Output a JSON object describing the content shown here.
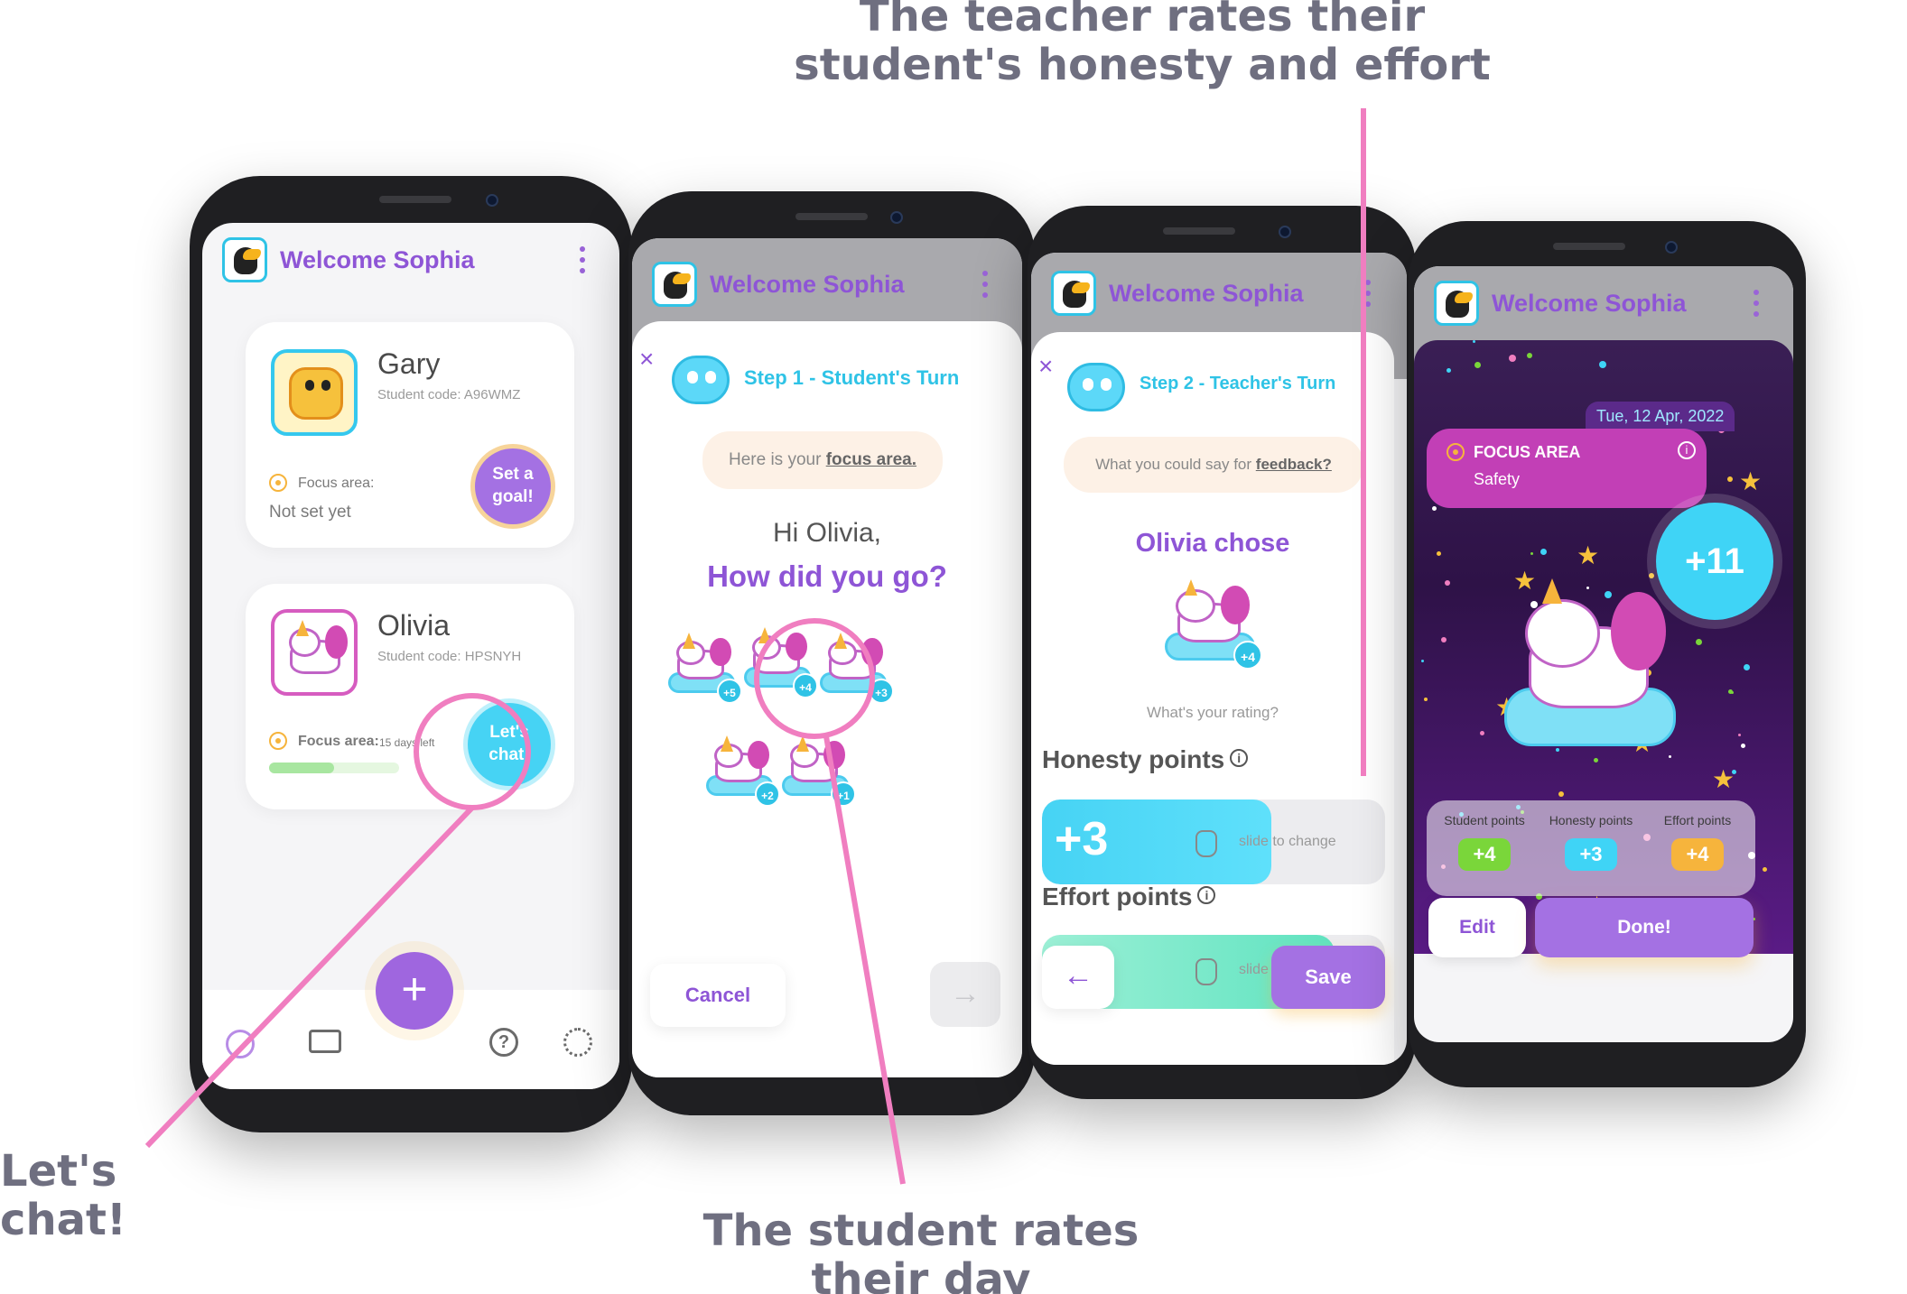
{
  "captions": {
    "top": "The teacher rates their student's honesty and effort",
    "left": "Let's chat!",
    "bottom": "The student rates their day"
  },
  "app": {
    "title": "Welcome Sophia",
    "logo_icon": "toucan-logo-icon",
    "menu_icon": "kebab-menu-icon"
  },
  "screen1": {
    "students": [
      {
        "name": "Gary",
        "code": "Student code: A96WMZ",
        "focus_label": "Focus area:",
        "focus_value": "Not set yet",
        "action": "Set a goal!"
      },
      {
        "name": "Olivia",
        "code": "Student code: HPSNYH",
        "focus_label": "Focus area:",
        "days_left": "15 days left",
        "action": "Let's chat!",
        "progress": 0.5
      }
    ],
    "nav": {
      "fab": "+",
      "help": "?"
    }
  },
  "screen2": {
    "step": "Step 1 - Student's Turn",
    "focus_prompt_prefix": "Here is your",
    "focus_prompt_link": "focus area.",
    "greeting": "Hi Olivia,",
    "question": "How did you go?",
    "ratings": [
      "+5",
      "+4",
      "+3",
      "+2",
      "+1"
    ],
    "cancel": "Cancel",
    "next": "→"
  },
  "screen3": {
    "step": "Step 2 - Teacher's Turn",
    "feedback_prefix": "What you could say for",
    "feedback_link": "feedback?",
    "chose": "Olivia chose",
    "chosen_badge": "+4",
    "rating_prompt": "What's your rating?",
    "honesty_label": "Honesty points",
    "honesty_value": "+3",
    "slide_hint": "slide to change",
    "effort_label": "Effort points",
    "effort_hint": "slide",
    "back": "←",
    "save": "Save"
  },
  "screen4": {
    "date": "Tue, 12 Apr, 2022",
    "focus_title": "FOCUS AREA",
    "focus_value": "Safety",
    "total": "+11",
    "points": [
      {
        "label": "Student points",
        "value": "+4",
        "color": "#7ad63a"
      },
      {
        "label": "Honesty points",
        "value": "+3",
        "color": "#3fd4f6"
      },
      {
        "label": "Effort points",
        "value": "+4",
        "color": "#f6b43c"
      }
    ],
    "edit": "Edit",
    "done": "Done!"
  },
  "colors": {
    "brand_purple": "#8e55d6",
    "accent_cyan": "#2fc3e6",
    "annotation_pink": "#f07ec0"
  }
}
